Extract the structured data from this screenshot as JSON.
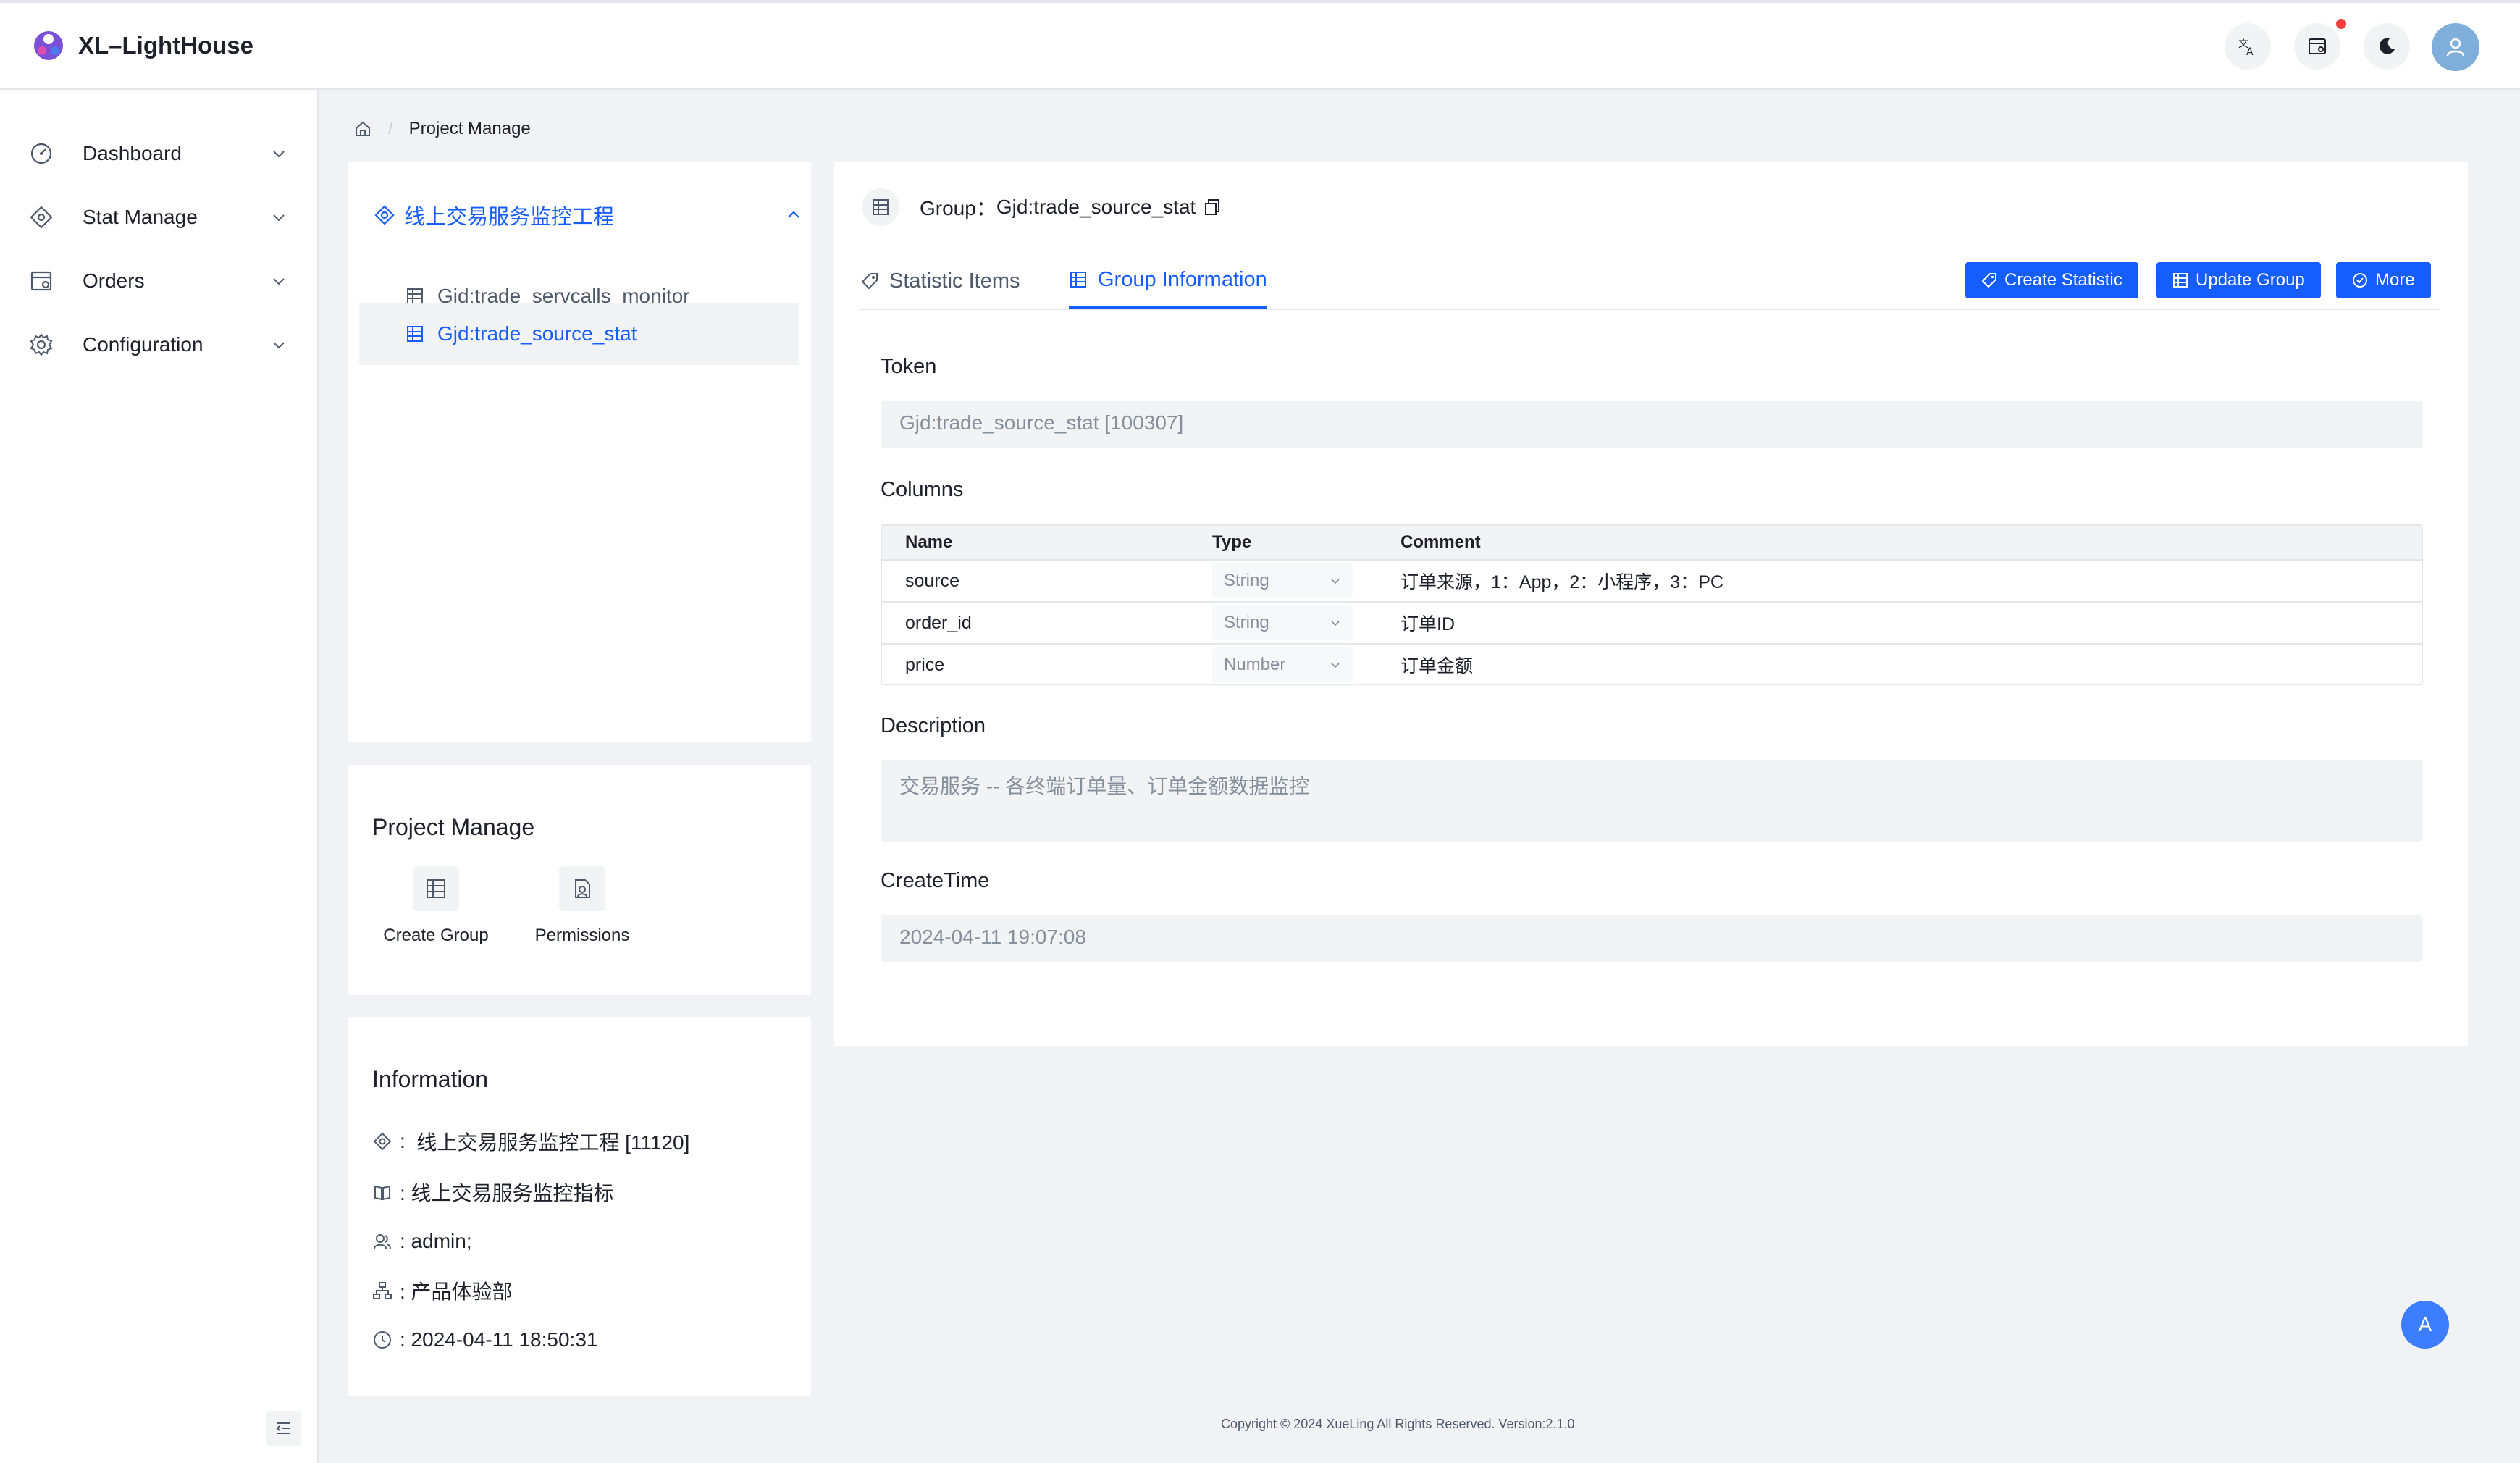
{
  "app": {
    "title": "XL–LightHouse"
  },
  "header": {
    "icons": [
      "translate-icon",
      "notification-icon",
      "moon-icon",
      "user-icon"
    ],
    "accent": "#165dff"
  },
  "sidebar": {
    "items": [
      {
        "label": "Dashboard",
        "icon": "dashboard-icon"
      },
      {
        "label": "Stat Manage",
        "icon": "stat-icon"
      },
      {
        "label": "Orders",
        "icon": "orders-icon"
      },
      {
        "label": "Configuration",
        "icon": "gear-icon"
      }
    ]
  },
  "breadcrumb": {
    "current": "Project Manage"
  },
  "tree": {
    "root": "线上交易服务监控工程",
    "items": [
      {
        "label": "Gjd:trade_servcalls_monitor",
        "selected": false
      },
      {
        "label": "Gjd:trade_source_stat",
        "selected": true
      }
    ]
  },
  "project_manage": {
    "title": "Project Manage",
    "actions": [
      {
        "label": "Create Group",
        "icon": "table-icon"
      },
      {
        "label": "Permissions",
        "icon": "permission-icon"
      }
    ]
  },
  "information": {
    "title": "Information",
    "project": "线上交易服务监控工程  [11120]",
    "description": ": 线上交易服务监控指标",
    "admins": ": admin;",
    "department": ": 产品体验部",
    "created": ": 2024-04-11 18:50:31"
  },
  "group": {
    "prefix": "Group：",
    "name": "Gjd:trade_source_stat",
    "tabs": [
      {
        "label": "Statistic Items",
        "active": false
      },
      {
        "label": "Group Information",
        "active": true
      }
    ],
    "buttons": {
      "create_statistic": "Create Statistic",
      "update_group": "Update Group",
      "more": "More"
    },
    "token_label": "Token",
    "token_value": "Gjd:trade_source_stat [100307]",
    "columns_label": "Columns",
    "columns_headers": {
      "name": "Name",
      "type": "Type",
      "comment": "Comment"
    },
    "columns": [
      {
        "name": "source",
        "type": "String",
        "comment": "订单来源，1：App，2：小程序，3：PC"
      },
      {
        "name": "order_id",
        "type": "String",
        "comment": "订单ID"
      },
      {
        "name": "price",
        "type": "Number",
        "comment": "订单金额"
      }
    ],
    "description_label": "Description",
    "description_value": "交易服务 -- 各终端订单量、订单金额数据监控",
    "createtime_label": "CreateTime",
    "createtime_value": "2024-04-11 19:07:08"
  },
  "footer": {
    "text": "Copyright © 2024 XueLing All Rights Reserved.    Version:2.1.0"
  },
  "float_button": {
    "label": "A"
  }
}
